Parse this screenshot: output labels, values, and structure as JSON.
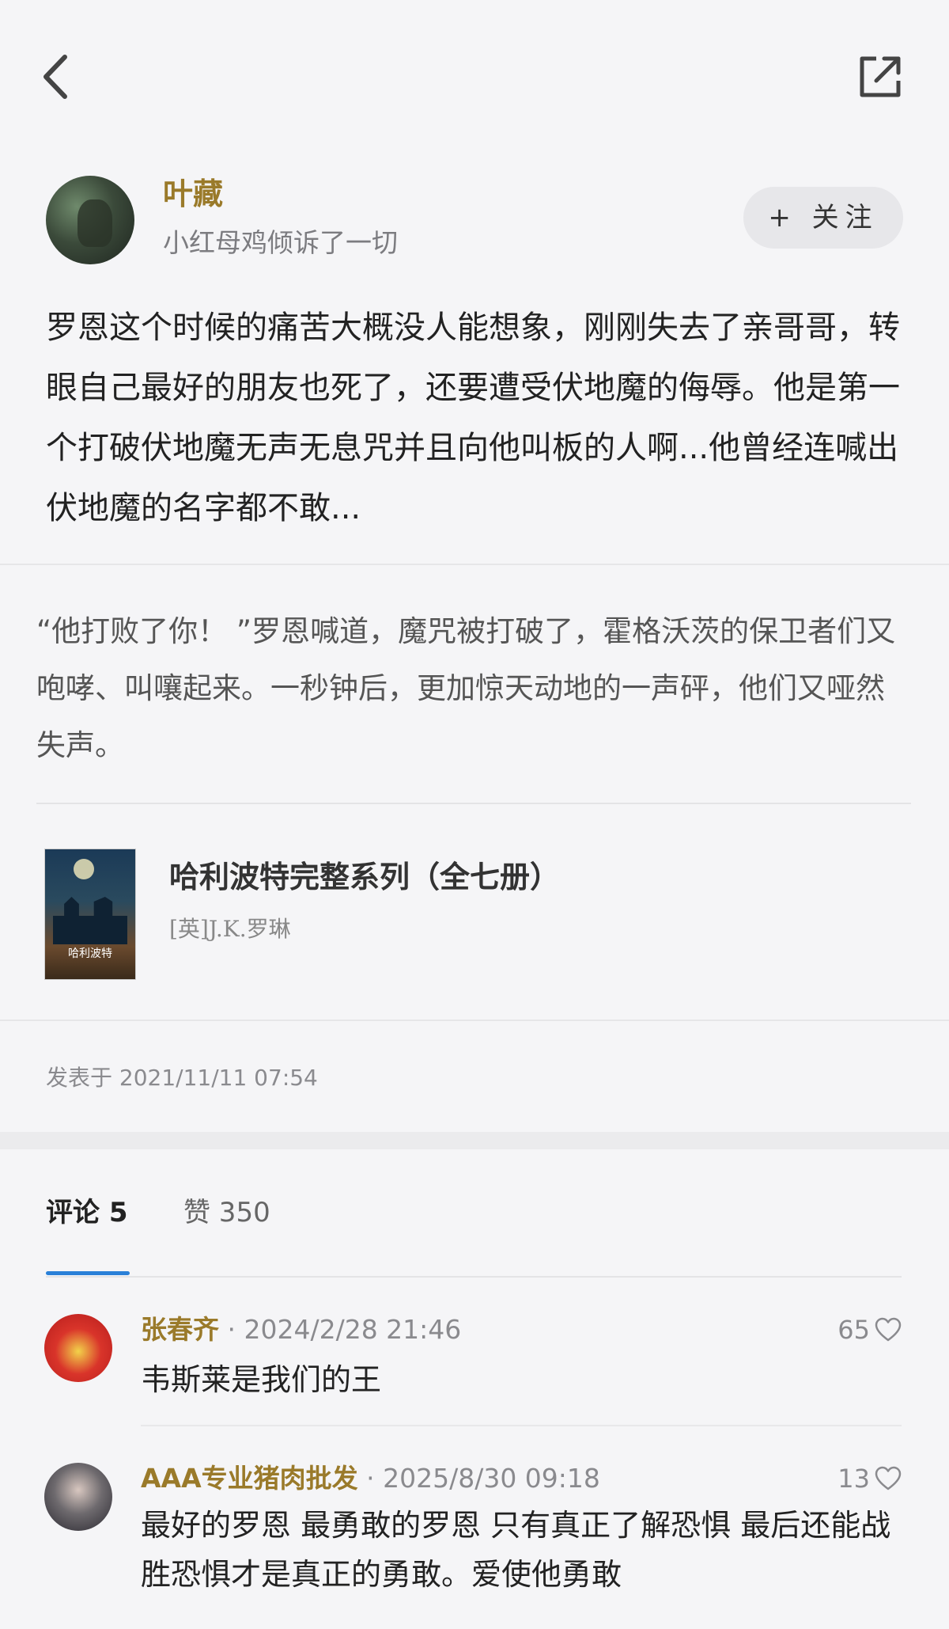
{
  "author": {
    "name": "叶藏",
    "subtitle": "小红母鸡倾诉了一切",
    "follow_label": "+ 关注"
  },
  "post": {
    "body": "罗恩这个时候的痛苦大概没人能想象，刚刚失去了亲哥哥，转眼自己最好的朋友也死了，还要遭受伏地魔的侮辱。他是第一个打破伏地魔无声无息咒并且向他叫板的人啊...他曾经连喊出伏地魔的名字都不敢...",
    "quote": "“他打败了你！ ”罗恩喊道，魔咒被打破了，霍格沃茨的保卫者们又咆哮、叫嚷起来。一秒钟后，更加惊天动地的一声砰，他们又哑然失声。",
    "book_title": "哈利波特完整系列（全七册）",
    "book_author": "[英]J.K.罗琳",
    "book_cover_logo": "哈利波特",
    "published": "发表于 2021/11/11 07:54"
  },
  "tabs": {
    "comments": "评论 5",
    "likes": "赞 350"
  },
  "comments": [
    {
      "name": "张春齐",
      "time": "· 2024/2/28 21:46",
      "likes": "65",
      "text": "韦斯莱是我们的王"
    },
    {
      "name": "AAA专业猪肉批发",
      "time": "· 2025/8/30 09:18",
      "likes": "13",
      "text": "最好的罗恩 最勇敢的罗恩 只有真正了解恐惧 最后还能战胜恐惧才是真正的勇敢。爱使他勇敢"
    }
  ],
  "icons": {
    "back": "chevron-left-icon",
    "share": "share-icon",
    "like": "heart-icon"
  },
  "colors": {
    "author_name": "#9a7a2a",
    "tab_active": "#2a80d8"
  }
}
